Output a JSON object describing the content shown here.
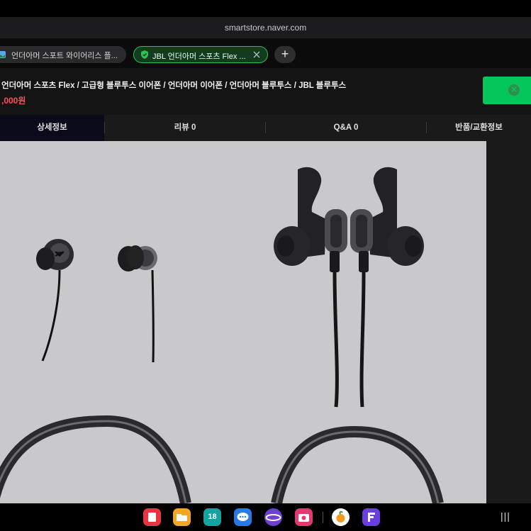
{
  "browser": {
    "url": "smartstore.naver.com",
    "tabs": [
      {
        "label": "언더아머 스포트 와이어리스 플..."
      },
      {
        "label": "JBL 언더아머 스포츠 Flex ...",
        "active": true
      }
    ],
    "new_tab_label": "+"
  },
  "product": {
    "title": "언더아머 스포츠 Flex / 고급형 블루투스 이어폰 / 언더아머 이어폰 / 언더아머 블루투스 / JBL 블루투스",
    "price": ",000원"
  },
  "product_tabs": [
    {
      "label": "상세정보"
    },
    {
      "label": "리뷰 0"
    },
    {
      "label": "Q&A 0"
    },
    {
      "label": "반품/교환정보"
    }
  ],
  "dock": {
    "calendar_day": "18",
    "apps": [
      "flipboard-icon",
      "files-icon",
      "calendar-icon",
      "messages-icon",
      "internet-icon",
      "camera-icon",
      "fruit-icon",
      "f-app-icon"
    ],
    "menu_label": "|||"
  },
  "colors": {
    "accent_green": "#03c75a",
    "price_red": "#ff4f5a",
    "content_bg": "#c9c9cb"
  }
}
